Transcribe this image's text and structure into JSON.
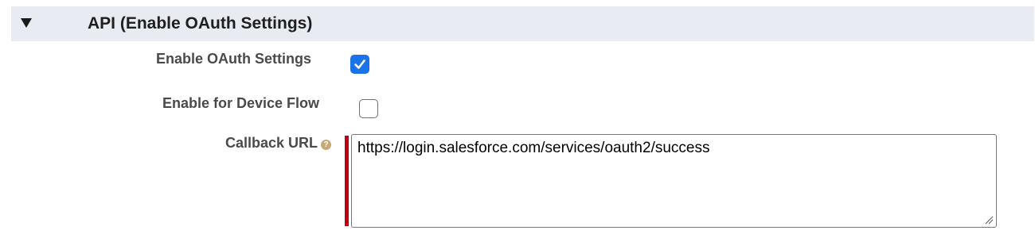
{
  "section": {
    "title": "API (Enable OAuth Settings)",
    "toggle_icon": "triangle-down-icon",
    "background_color": "#e8ebf1"
  },
  "fields": {
    "enable_oauth": {
      "label": "Enable OAuth Settings",
      "checked": true,
      "check_color": "#1a73e8"
    },
    "device_flow": {
      "label": "Enable for Device Flow",
      "checked": false
    },
    "callback_url": {
      "label": "Callback URL",
      "help_icon": "help-icon",
      "value": "https://login.salesforce.com/services/oauth2/success",
      "required": true,
      "required_color": "#c00012"
    }
  }
}
